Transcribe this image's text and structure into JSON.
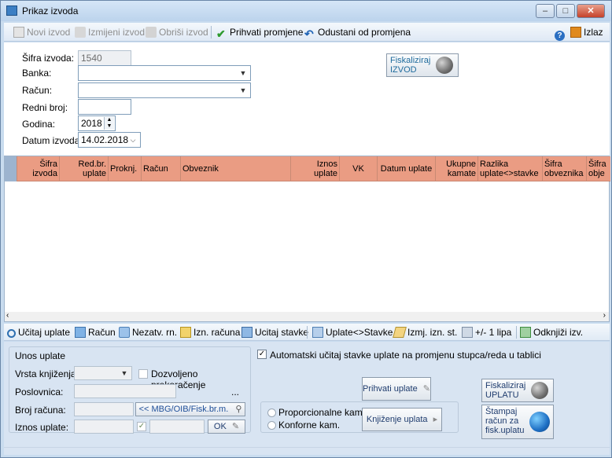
{
  "window": {
    "title": "Prikaz izvoda",
    "controls": [
      "–",
      "□",
      "✕"
    ]
  },
  "toolbar": {
    "new": "Novi izvod",
    "edit": "Izmijeni izvod",
    "delete": "Obriši izvod",
    "accept": "Prihvati promjene",
    "cancel": "Odustani od promjena",
    "exit": "Izlaz"
  },
  "form": {
    "sifra_label": "Šifra izvoda:",
    "sifra_value": "1540",
    "banka_label": "Banka:",
    "banka_value": "",
    "racun_label": "Račun:",
    "racun_value": "",
    "redni_label": "Redni broj:",
    "redni_value": "",
    "godina_label": "Godina:",
    "godina_value": "2018",
    "datum_label": "Datum izvoda:",
    "datum_value": "14.02.2018",
    "fisk_izvod_1": "Fiskaliziraj",
    "fisk_izvod_2": "IZVOD"
  },
  "grid": {
    "columns": [
      "Šifra izvoda",
      "Red.br. uplate",
      "Proknj.",
      "Račun",
      "Obveznik",
      "Iznos uplate",
      "VK",
      "Datum uplate",
      "Ukupne kamate",
      "Razlika uplate<>stavke",
      "Šifra obveznika",
      "Šifra obje"
    ],
    "rows": []
  },
  "bottom_toolbar": {
    "ucitaj_uplate": "Učitaj uplate",
    "racun": "Račun",
    "nezatv": "Nezatv. rn.",
    "izn_racuna": "Izn. računa",
    "ucitaj_stavke": "Ucitaj stavke",
    "uplate_stavke": "Uplate<>Stavke",
    "izmj_izn": "Izmj. izn. st.",
    "lipa": "+/- 1 lipa",
    "odknjizi": "Odknjiži izv."
  },
  "unos": {
    "group_title": "Unos uplate",
    "vrsta_label": "Vrsta knjiženja:",
    "dozvoljeno": "Dozvoljeno prekoračenje",
    "poslovnica_label": "Poslovnica:",
    "broj_racuna_label": "Broj računa:",
    "mbg_button": "<< MBG/OIB/Fisk.br.m.",
    "iznos_label": "Iznos uplate:",
    "ok_button": "OK",
    "ellipsis": "..."
  },
  "right_panel": {
    "auto_ucitaj": "Automatski učitaj stavke uplate na promjenu stupca/reda u tablici",
    "prihvati": "Prihvati uplate",
    "knjizenje": "Knjiženje uplata",
    "proporcionalne": "Proporcionalne kam.",
    "konforne": "Konforne kam.",
    "fisk_uplatu_1": "Fiskaliziraj",
    "fisk_uplatu_2": "UPLATU",
    "stampaj_1": "Štampaj",
    "stampaj_2": "račun za",
    "stampaj_3": "fisk.uplatu"
  }
}
